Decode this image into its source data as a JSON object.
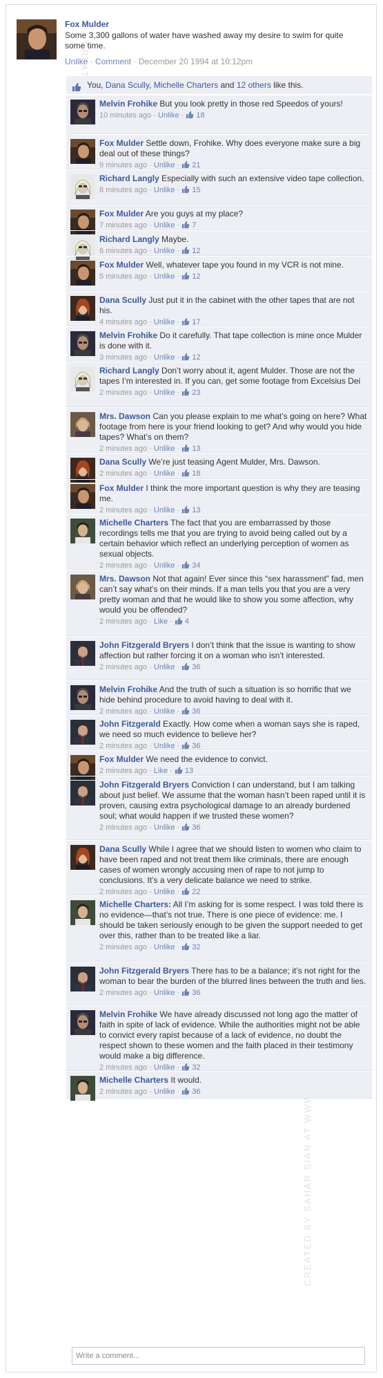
{
  "post": {
    "author": "Fox Mulder",
    "text": "Some 3,300 gallons of water have washed away my desire to swim for quite some time.",
    "action_unlike": "Unlike",
    "action_comment": "Comment",
    "timestamp": "December 20 1994 at 10:12pm",
    "sep": " · "
  },
  "likes": {
    "you": "You, ",
    "name1": "Dana Scully",
    "comma": ", ",
    "name2": "Michelle Charters",
    "and": " and ",
    "others": "12 others",
    "tail": " like this."
  },
  "comments": [
    {
      "name": "Melvin Frohike",
      "text": "But you look pretty in those red Speedos of yours!",
      "time": "10 minutes ago",
      "action": "Unlike",
      "likes": "18",
      "avatar": "frohike"
    },
    {
      "name": "Fox Mulder",
      "text": "Settle down, Frohike. Why does everyone make sure a big deal out of these things?",
      "time": "9 minutes ago",
      "action": "Unlike",
      "likes": "21",
      "avatar": "mulder"
    },
    {
      "name": "Richard Langly",
      "text": "Especially with such an extensive video tape collection.",
      "time": "8 minutes ago",
      "action": "Unlike",
      "likes": "15",
      "avatar": "langly"
    },
    {
      "name": "Fox Mulder",
      "text": "Are you guys at my place?",
      "time": "7 minutes ago",
      "action": "Unlike",
      "likes": "7",
      "avatar": "mulder"
    },
    {
      "name": "Richard Langly",
      "text": "Maybe.",
      "time": "6 minutes ago",
      "action": "Unlike",
      "likes": "12",
      "avatar": "langly"
    },
    {
      "name": "Fox Mulder",
      "text": "Well, whatever tape you found in my VCR is not mine.",
      "time": "5 minutes ago",
      "action": "Unlike",
      "likes": "12",
      "avatar": "mulder"
    },
    {
      "name": "Dana Scully",
      "text": "Just put it in the cabinet with the other tapes that are not his.",
      "time": "4 minutes ago",
      "action": "Unlike",
      "likes": "17",
      "avatar": "scully"
    },
    {
      "name": "Melvin Frohike",
      "text": "Do it carefully. That tape collection is mine once Mulder is done with it.",
      "time": "3 minutes ago",
      "action": "Unlike",
      "likes": "12",
      "avatar": "frohike"
    },
    {
      "name": "Richard Langly",
      "text": "Don’t worry about it, agent Mulder. Those are not the tapes I’m interested in. If you can, get some footage from Excelsius Dei",
      "time": "2 minutes ago",
      "action": "Unlike",
      "likes": "23",
      "avatar": "langly"
    },
    {
      "name": "Mrs. Dawson",
      "text": "Can you please explain to me what’s going on here? What footage from here is your friend looking to get? And why would you hide tapes? What’s on them?",
      "time": "2 minutes ago",
      "action": "Unlike",
      "likes": "13",
      "avatar": "dawson"
    },
    {
      "name": "Dana Scully",
      "text": "We’re just teasing Agent Mulder, Mrs. Dawson.",
      "time": "2 minutes ago",
      "action": "Unlike",
      "likes": "18",
      "avatar": "scully"
    },
    {
      "name": "Fox Mulder",
      "text": "I think the more important question is why they are teasing me.",
      "time": "2 minutes ago",
      "action": "Unlike",
      "likes": "13",
      "avatar": "mulder"
    },
    {
      "name": "Michelle Charters",
      "text": "The fact that you are embarrassed by those recordings tells me that you are trying to avoid being called out by a certain behavior which reflect an underlying perception of women as sexual objects.",
      "time": "2 minutes ago",
      "action": "Unlike",
      "likes": "34",
      "avatar": "charters"
    },
    {
      "name": "Mrs. Dawson",
      "text": "Not that again! Ever since this “sex harassment” fad, men can’t say what’s on their minds. If a man tells you that you are a very pretty woman and that he would like to show you some affection, why would you be offended?",
      "time": "2 minutes ago",
      "action": "Like",
      "likes": "4",
      "avatar": "dawson"
    },
    {
      "name": "John Fitzgerald Bryers",
      "text": "I don’t think that the issue is wanting to show affection but rather forcing it on a woman who isn’t interested.",
      "time": "2 minutes ago",
      "action": "Unlike",
      "likes": "36",
      "avatar": "byers"
    },
    {
      "name": "Melvin Frohike",
      "text": "And the truth of such a situation is so horrific that we hide behind procedure to avoid having to deal with it.",
      "time": "2 minutes ago",
      "action": "Unlike",
      "likes": "36",
      "avatar": "frohike"
    },
    {
      "name": "John Fitzgerald",
      "text": "Exactly. How come when a woman says she is raped, we need so much evidence to believe her?",
      "time": "2 minutes ago",
      "action": "Unlike",
      "likes": "36",
      "avatar": "byers"
    },
    {
      "name": "Fox Mulder",
      "text": "We need the evidence to convict.",
      "time": "2 minutes ago",
      "action": "Like",
      "likes": "13",
      "avatar": "mulder"
    },
    {
      "name": "John Fitzgerald Bryers",
      "text": "Conviction I can understand, but I am talking about just belief. We assume that the woman hasn’t been raped until it is proven, causing extra psychological damage to an already burdened soul; what would happen if we trusted these women?",
      "time": "2 minutes ago",
      "action": "Unlike",
      "likes": "36",
      "avatar": "byers"
    },
    {
      "name": "Dana Scully",
      "text": "While I agree that we should listen to women who claim to have been raped and not treat them like criminals, there are enough cases of women wrongly accusing men of rape to not jump to conclusions. It’s a very delicate balance we need to strike.",
      "time": "2 minutes ago",
      "action": "Unlike",
      "likes": "22",
      "avatar": "scully"
    },
    {
      "name": "Michelle Charters:",
      "text": "All I’m asking for is some respect. I was told there is no evidence—that’s not true. There is one piece of evidence: me. I should be taken seriously enough to be given the support needed to get over this, rather than to be treated like a liar.",
      "time": "2 minutes ago",
      "action": "Unlike",
      "likes": "32",
      "avatar": "charters"
    },
    {
      "name": "John Fitzgerald Bryers",
      "text": "There has to be a balance; it’s not right for the woman to bear the burden of the blurred lines between the truth and lies.",
      "time": "2 minutes ago",
      "action": "Unlike",
      "likes": "36",
      "avatar": "byers"
    },
    {
      "name": "Melvin Frohike",
      "text": "We have already discussed not long ago the matter of faith in spite of lack of evidence. While the authorities might not be able to convict every rapist because of a lack of evidence, no doubt the respect shown to these women and the faith placed in their testimony would make a big difference.",
      "time": "2 minutes ago",
      "action": "Unlike",
      "likes": "32",
      "avatar": "frohike"
    },
    {
      "name": "Michelle Charters",
      "text": "It would.",
      "time": "2 minutes ago",
      "action": "Unlike",
      "likes": "36",
      "avatar": "charters"
    }
  ],
  "write_placeholder": "Write a comment...",
  "watermark": "CREATED BY SAHAR SIAN AT WWW.SAHARSBLOG.COM",
  "colors": {
    "link": "#3b5998",
    "meta_link": "#6d84b4",
    "thread_bg": "#edeff4"
  },
  "icons": {
    "like": "thumbs-up-icon"
  }
}
